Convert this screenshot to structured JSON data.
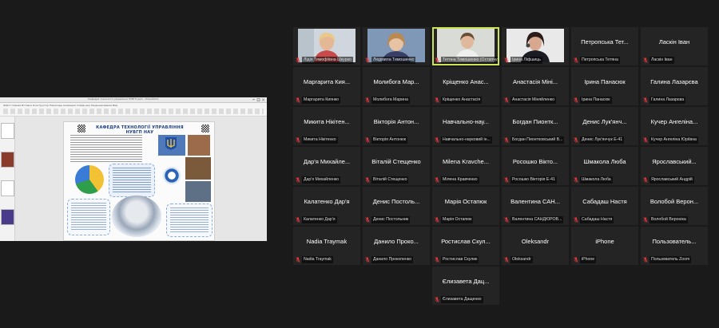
{
  "share": {
    "window_title": "Кафедра технології управління НУВГП.pptx - PowerPoint",
    "ribbon_tabs": "Файл  Главная  Вставка  Конструктор  Переходы  Анимация  Слайд-шоу  Рецензирование  Вид",
    "slide_title": "КАФЕДРА ТЕХНОЛОГІЇ УПРАВЛІННЯ НУВГП НАУ"
  },
  "participants": [
    {
      "display": "",
      "label": "Лідія Тимофіївна Шкурко",
      "video": "v1"
    },
    {
      "display": "",
      "label": "Людмила Тимошенко",
      "video": "v2"
    },
    {
      "display": "",
      "label": "Тетяна Тимошенко (Остапчук)",
      "video": "v3",
      "active": true
    },
    {
      "display": "",
      "label": "Ірина Ліфшиць",
      "video": "v4"
    },
    {
      "display": "Петропська Тет...",
      "label": "Петропська Тетяна"
    },
    {
      "display": "Ласкін Іван",
      "label": "Ласкін Іван"
    },
    {
      "display": "Маргарита Кия...",
      "label": "Маргарита Киянко"
    },
    {
      "display": "Молибога Мар...",
      "label": "Молибога Марина"
    },
    {
      "display": "Кріщенко Анас...",
      "label": "Кріщенко Анастасія"
    },
    {
      "display": "Анастасія Міні...",
      "label": "Анастасія Міняйленко"
    },
    {
      "display": "Ірина Панасюк",
      "label": "Ірина Панасюк"
    },
    {
      "display": "Галина Лазарєва",
      "label": "Галина Лазарєва"
    },
    {
      "display": "Микита Нікітен...",
      "label": "Микита Нікітенко"
    },
    {
      "display": "Вікторія Антон...",
      "label": "Вікторія Антонюк"
    },
    {
      "display": "Навчально-нау...",
      "label": "Навчально-науковий ін..."
    },
    {
      "display": "Богдан Пионтк...",
      "label": "Богдан Пионтковський В..."
    },
    {
      "display": "Денис Лук'янч...",
      "label": "Денис Лук'янчук Е-41"
    },
    {
      "display": "Кучер Ангеліна...",
      "label": "Кучер Ангеліна Юріївна"
    },
    {
      "display": "Дар'я Михайле...",
      "label": "Дар'я Михайленко"
    },
    {
      "display": "Віталій Стещенко",
      "label": "Віталій Стещенко"
    },
    {
      "display": "Milena Kravche...",
      "label": "Мілена Кравченко"
    },
    {
      "display": "Росошко Вікто...",
      "label": "Росошко Вікторія Е-41"
    },
    {
      "display": "Шмакола Люба",
      "label": "Шмакола Люба"
    },
    {
      "display": "Ярославський...",
      "label": "Ярославський Андрій"
    },
    {
      "display": "Калатенко Дар'я",
      "label": "Калатенко Дар'я"
    },
    {
      "display": "Денис Постоль...",
      "label": "Денис Постольник"
    },
    {
      "display": "Марія Остапюк",
      "label": "Марія Остапюк"
    },
    {
      "display": "Валентина САН...",
      "label": "Валентина САНДЮРОВ..."
    },
    {
      "display": "Сабадаш Настя",
      "label": "Сабадаш Настя"
    },
    {
      "display": "Волобой Верон...",
      "label": "Волобой Вероніка"
    },
    {
      "display": "Nadia Traymak",
      "label": "Nadia Traymak"
    },
    {
      "display": "Данило Проко...",
      "label": "Данило Прокопенко"
    },
    {
      "display": "Ростислав Скул...",
      "label": "Ростислав Скулик"
    },
    {
      "display": "Oleksandr",
      "label": "Oleksandr"
    },
    {
      "display": "iPhone",
      "label": "iPhone"
    },
    {
      "display": "Пользователь...",
      "label": "Пользователь Zoom"
    },
    {
      "display": "Єлизавета Дац...",
      "label": "Єлизавета Дащенко"
    }
  ],
  "colors": {
    "background": "#1a1a1a",
    "tile": "#242424",
    "active_speaker": "#c9e25a",
    "muted_mic": "#e0393e"
  },
  "icons": {
    "mic": "muted-mic-icon"
  }
}
